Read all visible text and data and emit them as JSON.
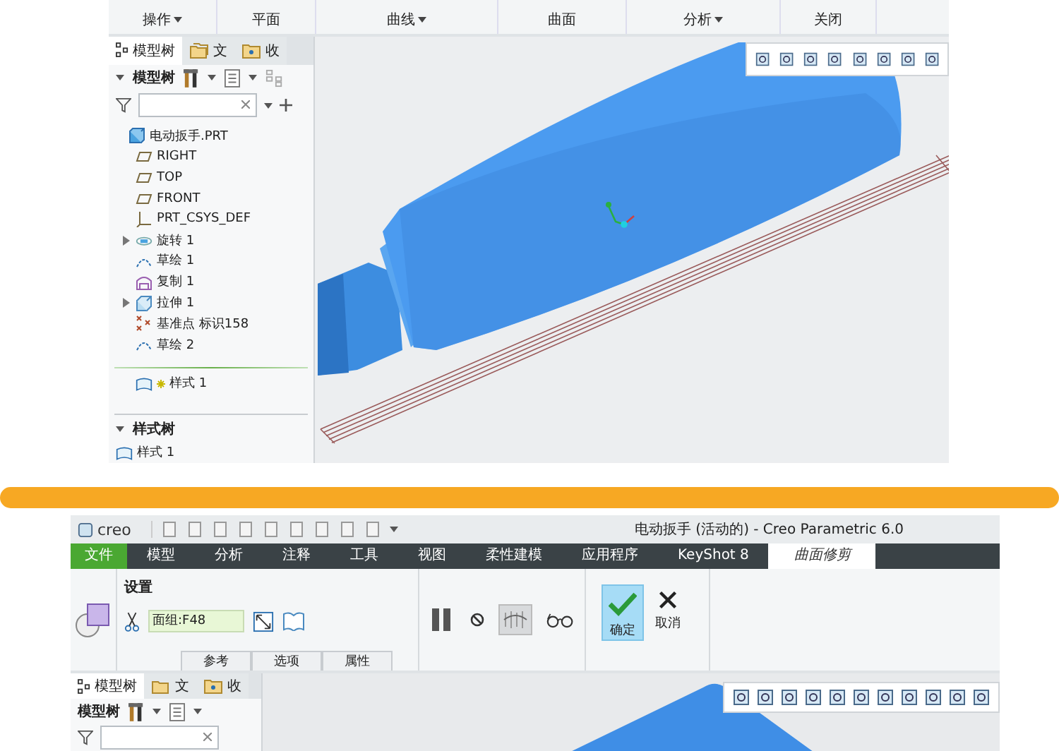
{
  "top_screenshot": {
    "ribbon_groups": [
      {
        "label": "操作",
        "dropdown": true
      },
      {
        "label": "平面",
        "dropdown": false
      },
      {
        "label": "曲线",
        "dropdown": true
      },
      {
        "label": "曲面",
        "dropdown": false
      },
      {
        "label": "分析",
        "dropdown": true
      },
      {
        "label": "关闭",
        "dropdown": false
      }
    ],
    "model_tree": {
      "tabs": [
        {
          "label": "模型树",
          "selected": true,
          "kind": "tree"
        },
        {
          "label": "文",
          "selected": false,
          "kind": "folder"
        },
        {
          "label": "收",
          "selected": false,
          "kind": "favorite"
        }
      ],
      "header": "模型树",
      "items": [
        {
          "label": "电动扳手.PRT",
          "kind": "part",
          "expandable": false,
          "indent": false
        },
        {
          "label": "RIGHT",
          "kind": "plane",
          "expandable": false,
          "indent": true
        },
        {
          "label": "TOP",
          "kind": "plane",
          "expandable": false,
          "indent": true
        },
        {
          "label": "FRONT",
          "kind": "plane",
          "expandable": false,
          "indent": true
        },
        {
          "label": "PRT_CSYS_DEF",
          "kind": "csys",
          "expandable": false,
          "indent": true
        },
        {
          "label": "旋转 1",
          "kind": "revolve",
          "expandable": true,
          "indent": true
        },
        {
          "label": "草绘 1",
          "kind": "sketch",
          "expandable": false,
          "indent": true
        },
        {
          "label": "复制 1",
          "kind": "copy",
          "expandable": false,
          "indent": true
        },
        {
          "label": "拉伸 1",
          "kind": "extrude",
          "expandable": true,
          "indent": true
        },
        {
          "label": "基准点 标识158",
          "kind": "datum-point",
          "expandable": false,
          "indent": true
        },
        {
          "label": "草绘 2",
          "kind": "sketch",
          "expandable": false,
          "indent": true
        }
      ],
      "insert_item": {
        "label": "样式 1"
      },
      "style_tree": {
        "header": "样式树",
        "items": [
          {
            "label": "样式 1"
          }
        ]
      }
    }
  },
  "bottom_screenshot": {
    "window": {
      "logo": "creo",
      "title": "电动扳手 (活动的) - Creo Parametric 6.0"
    },
    "menu_tabs": [
      {
        "label": "文件",
        "kind": "file",
        "selected": false
      },
      {
        "label": "模型",
        "kind": "tab",
        "selected": false
      },
      {
        "label": "分析",
        "kind": "tab",
        "selected": false
      },
      {
        "label": "注释",
        "kind": "tab",
        "selected": false
      },
      {
        "label": "工具",
        "kind": "tab",
        "selected": false
      },
      {
        "label": "视图",
        "kind": "tab",
        "selected": false
      },
      {
        "label": "柔性建模",
        "kind": "tab",
        "selected": false
      },
      {
        "label": "应用程序",
        "kind": "tab",
        "selected": false
      },
      {
        "label": "KeyShot 8",
        "kind": "tab",
        "selected": false
      },
      {
        "label": "曲面修剪",
        "kind": "tab",
        "selected": true
      }
    ],
    "ribbon": {
      "settings_label": "设置",
      "trim_object": {
        "value": "面组:F48"
      },
      "panel_tabs": [
        "参考",
        "选项",
        "属性"
      ],
      "tools": [
        {
          "kind": "pause",
          "pressed": false
        },
        {
          "kind": "no",
          "pressed": false
        },
        {
          "kind": "preview",
          "pressed": true
        },
        {
          "kind": "glasses",
          "pressed": false
        }
      ],
      "actions": [
        {
          "label": "确定",
          "kind": "ok",
          "selected": true
        },
        {
          "label": "取消",
          "kind": "cancel",
          "selected": false
        }
      ]
    },
    "model_tree": {
      "tabs": [
        {
          "label": "模型树",
          "selected": true,
          "kind": "tree"
        },
        {
          "label": "文",
          "selected": false,
          "kind": "folder"
        },
        {
          "label": "收",
          "selected": false,
          "kind": "favorite"
        }
      ],
      "header": "模型树"
    }
  }
}
